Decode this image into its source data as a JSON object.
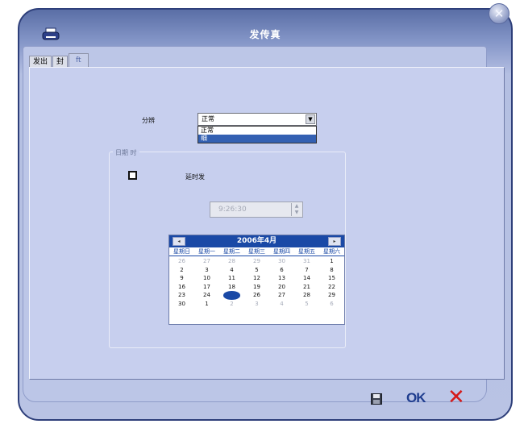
{
  "window": {
    "title": "发传真"
  },
  "tabs": [
    {
      "label": "发出"
    },
    {
      "label": "封"
    },
    {
      "label": "ft"
    }
  ],
  "form": {
    "resolution_label": "分辨",
    "resolution_value": "正常",
    "resolution_options": [
      "正常",
      "细"
    ],
    "datetime_group_label": "日期 时",
    "deferred_label": "延时发",
    "time_value": "9:26:30"
  },
  "calendar": {
    "month_title": "2006年4月",
    "prev": "◂",
    "next": "▸",
    "days_of_week": [
      "星期日",
      "星期一",
      "星期二",
      "星期三",
      "星期四",
      "星期五",
      "星期六"
    ],
    "days": [
      "26",
      "27",
      "28",
      "29",
      "30",
      "31",
      "1",
      "2",
      "3",
      "4",
      "5",
      "6",
      "7",
      "8",
      "9",
      "10",
      "11",
      "12",
      "13",
      "14",
      "15",
      "16",
      "17",
      "18",
      "19",
      "20",
      "21",
      "22",
      "23",
      "24",
      "25",
      "26",
      "27",
      "28",
      "29",
      "30",
      "1",
      "2",
      "3",
      "4",
      "5",
      "6"
    ],
    "selected_day": "25"
  },
  "footer": {
    "ok_label": "OK",
    "cancel_label": "✕"
  },
  "colors": {
    "accent": "#1a49a6",
    "cancel": "#d51a1a",
    "frame": "#2e3f7a"
  }
}
